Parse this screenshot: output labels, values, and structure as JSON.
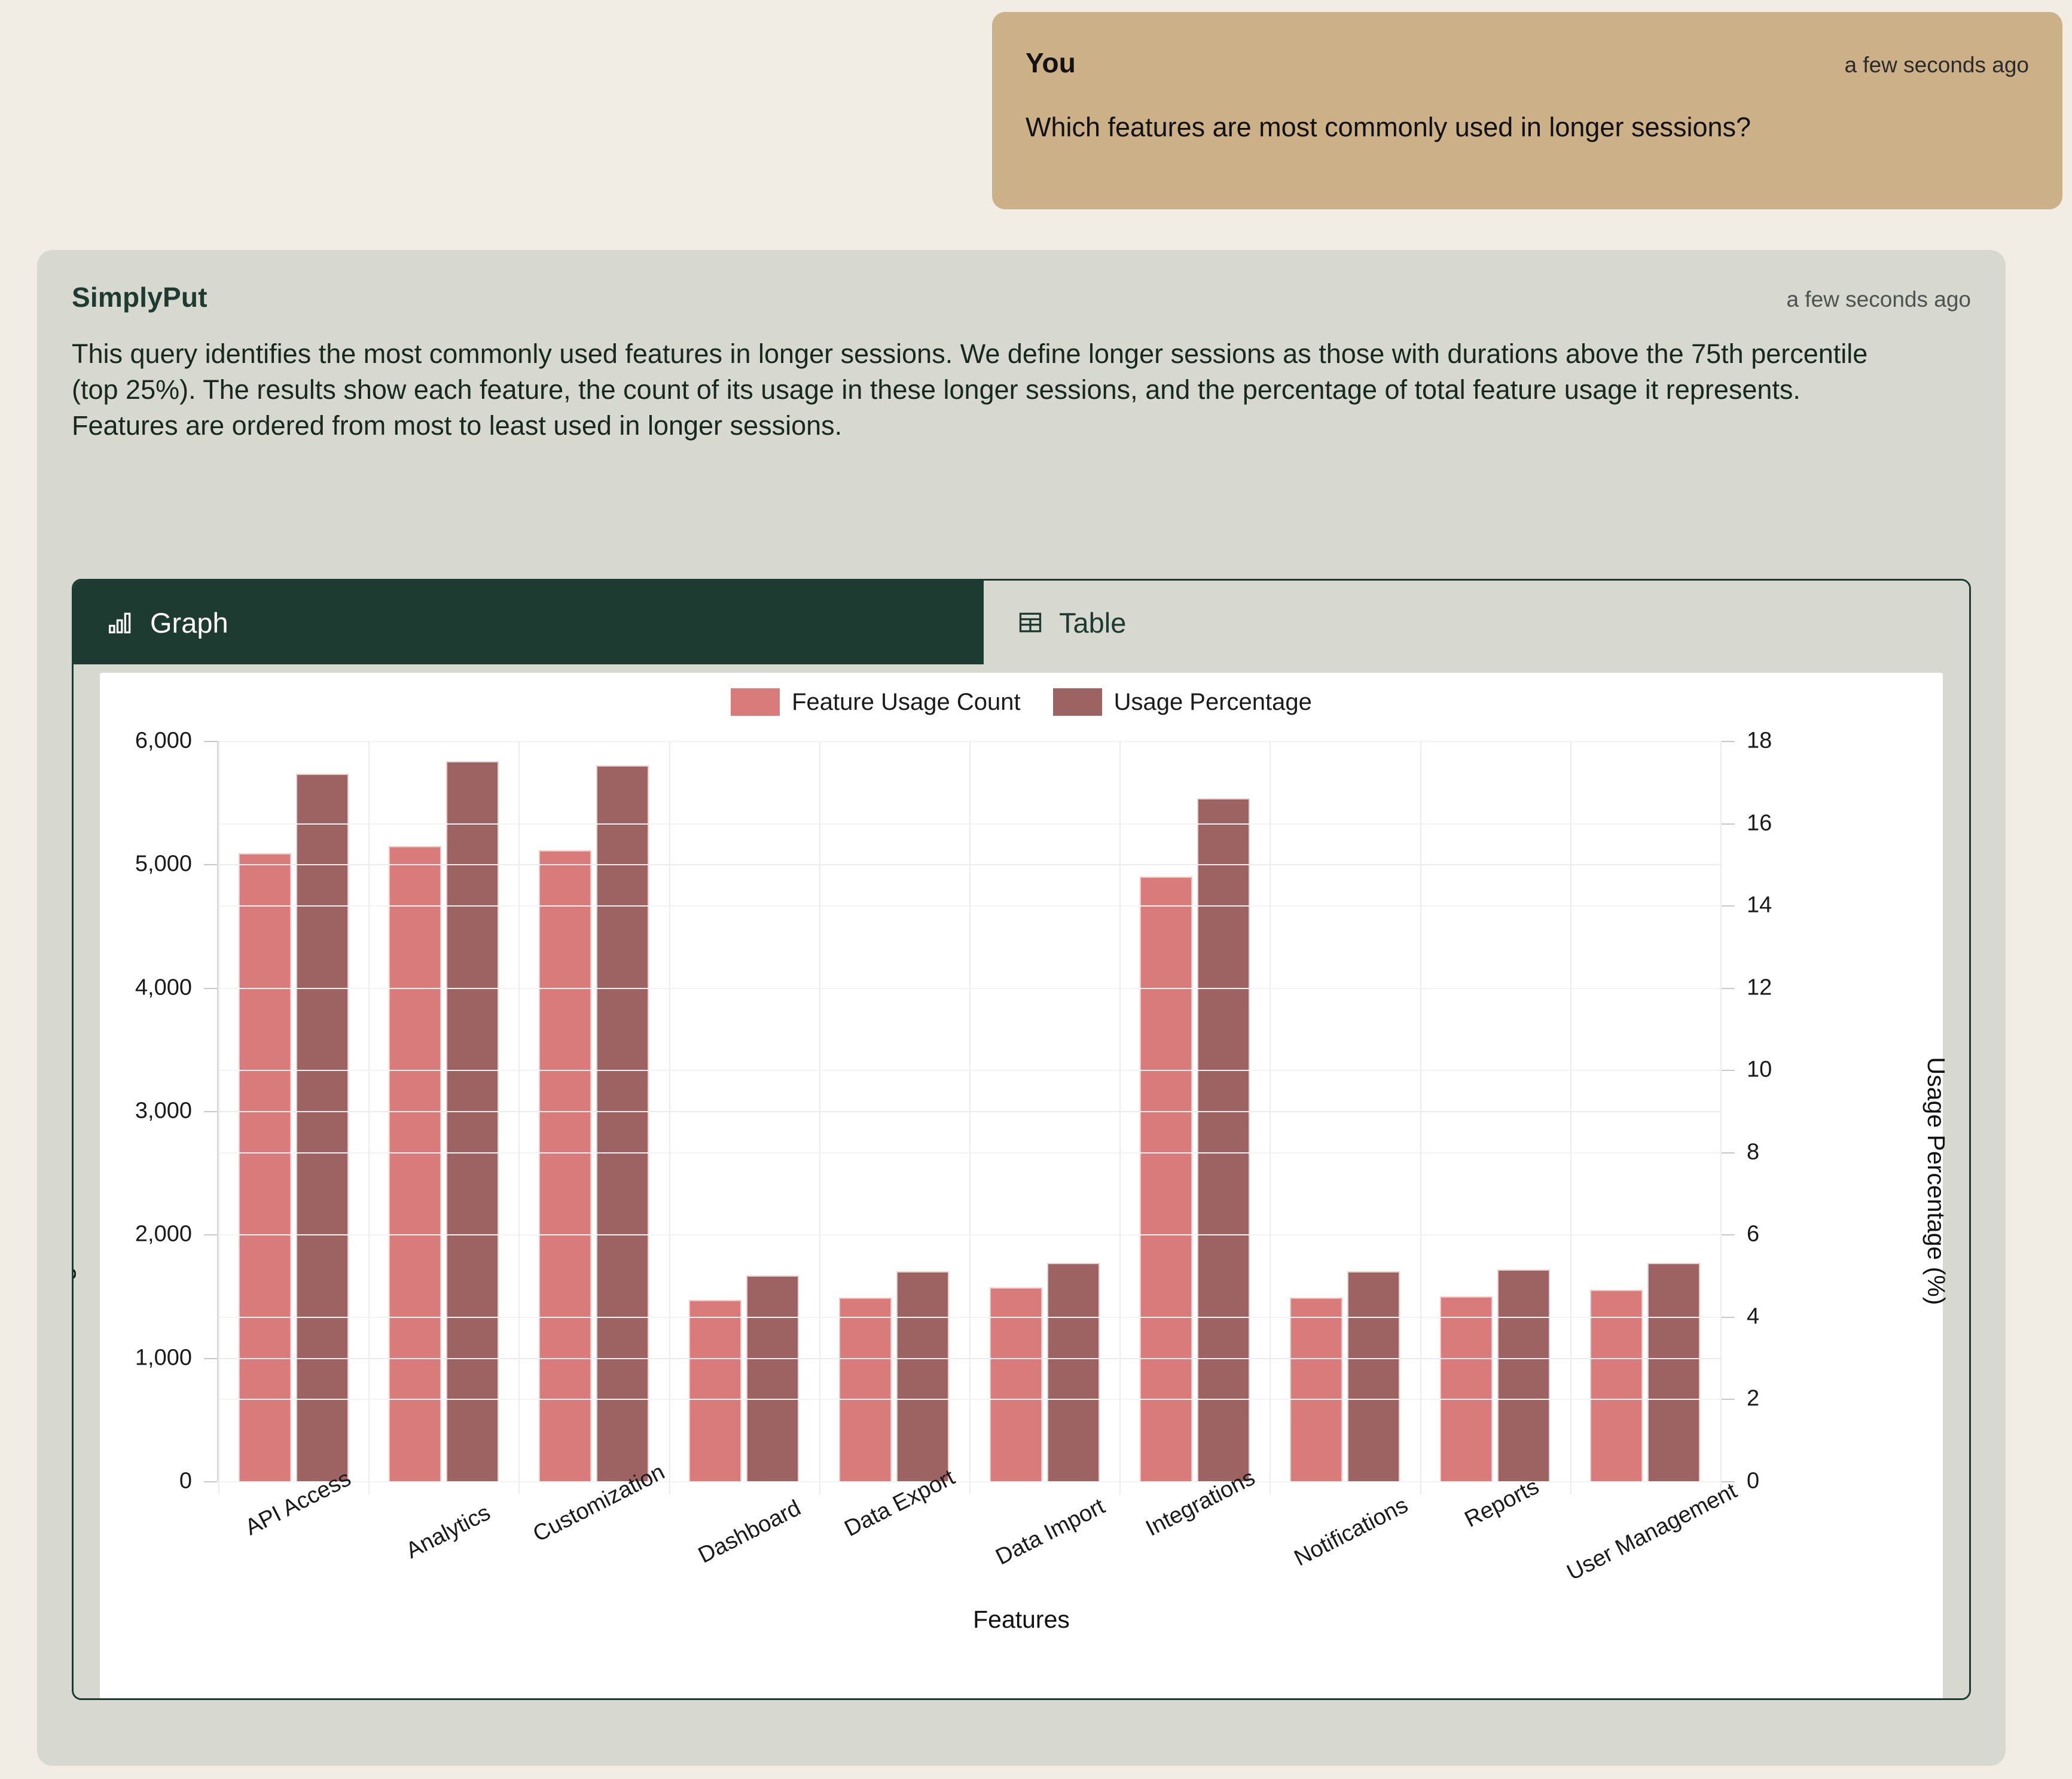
{
  "user": {
    "name": "You",
    "timestamp": "a few seconds ago",
    "message": "Which features are most commonly used in longer sessions?"
  },
  "assistant": {
    "name": "SimplyPut",
    "timestamp": "a few seconds ago",
    "body": "This query identifies the most commonly used features in longer sessions. We define longer sessions as those with durations above the 75th percentile (top 25%). The results show each feature, the count of its usage in these longer sessions, and the percentage of total feature usage it represents. Features are ordered from most to least used in longer sessions."
  },
  "tabs": [
    {
      "id": "graph",
      "label": "Graph",
      "icon": "bar-chart-icon",
      "active": true
    },
    {
      "id": "table",
      "label": "Table",
      "icon": "table-icon",
      "active": false
    }
  ],
  "colors": {
    "page_background": "#f2ede4",
    "user_bubble": "#cbb088",
    "assistant_bubble": "#d7d8d0",
    "accent_dark_green": "#1d3b30",
    "series_count": "#d97b7b",
    "series_percentage": "#9d6363"
  },
  "chart_data": {
    "type": "bar",
    "title": "",
    "xlabel": "Features",
    "ylabel": "Feature Usage Count",
    "y2label": "Usage Percentage (%)",
    "ylim": [
      0,
      6000
    ],
    "y2lim": [
      0,
      18
    ],
    "yticks": [
      "0",
      "1,000",
      "2,000",
      "3,000",
      "4,000",
      "5,000",
      "6,000"
    ],
    "y2ticks": [
      "0",
      "2",
      "4",
      "6",
      "8",
      "10",
      "12",
      "14",
      "16",
      "18"
    ],
    "grid": true,
    "legend_position": "top-center",
    "categories": [
      "API Access",
      "Analytics",
      "Customization",
      "Dashboard",
      "Data Export",
      "Data Import",
      "Integrations",
      "Notifications",
      "Reports",
      "User Management"
    ],
    "series": [
      {
        "name": "Feature Usage Count",
        "axis": "left",
        "color": "#d97b7b",
        "values": [
          5090,
          5145,
          5115,
          1470,
          1490,
          1570,
          4900,
          1490,
          1500,
          1550
        ]
      },
      {
        "name": "Usage Percentage",
        "axis": "right",
        "color": "#9d6363",
        "values": [
          17.2,
          17.5,
          17.4,
          5.0,
          5.1,
          5.3,
          16.6,
          5.1,
          5.15,
          5.3
        ]
      }
    ]
  }
}
